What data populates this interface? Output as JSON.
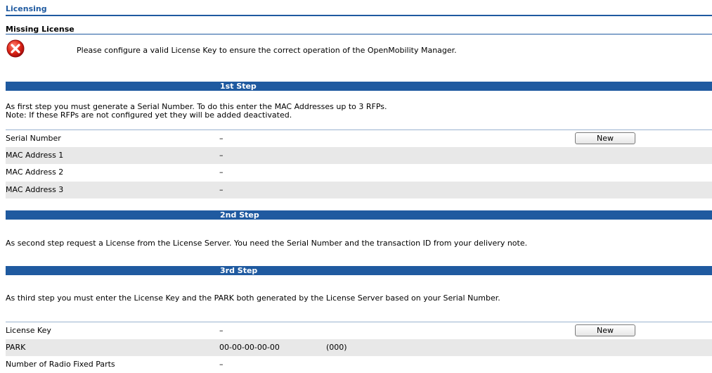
{
  "header": {
    "title": "Licensing"
  },
  "missing": {
    "title": "Missing License",
    "message": "Please configure a valid License Key to ensure the correct operation of the OpenMobility Manager."
  },
  "step1": {
    "label": "1st Step",
    "text_line1": "As first step you must generate a Serial Number. To do this enter the MAC Addresses up to 3 RFPs.",
    "text_line2": "Note: If these RFPs are not configured yet they will be added deactivated.",
    "rows": [
      {
        "label": "Serial Number",
        "value": "–"
      },
      {
        "label": "MAC Address 1",
        "value": "–"
      },
      {
        "label": "MAC Address 2",
        "value": "–"
      },
      {
        "label": "MAC Address 3",
        "value": "–"
      }
    ],
    "new_button": "New"
  },
  "step2": {
    "label": "2nd Step",
    "text": "As second step request a License from the License Server. You need the Serial Number and the transaction ID from your delivery note."
  },
  "step3": {
    "label": "3rd Step",
    "text": "As third step you must enter the License Key and the PARK both generated by the License Server based on your Serial Number.",
    "rows": [
      {
        "label": "License Key",
        "value": "–"
      },
      {
        "label": "PARK",
        "value": "00-00-00-00-00",
        "extra": "(000)"
      },
      {
        "label": "Number of Radio Fixed Parts",
        "value": "–"
      }
    ],
    "new_button": "New"
  },
  "colors": {
    "accent": "#1f5aa0",
    "row_alt": "#e8e8e8",
    "error": "#d42020"
  },
  "icons": {
    "error": "error-x-icon"
  }
}
